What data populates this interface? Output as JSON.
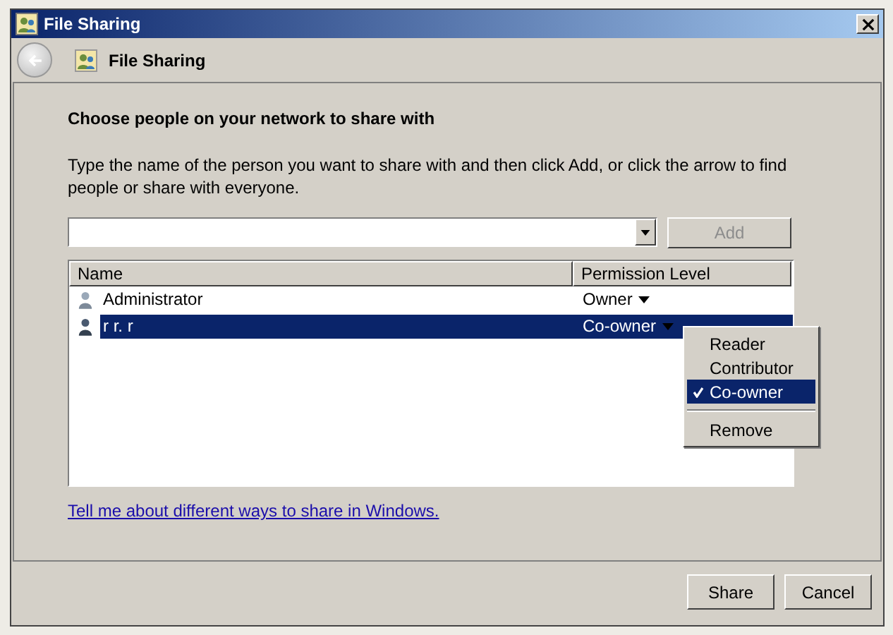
{
  "window": {
    "title": "File Sharing"
  },
  "nav": {
    "title": "File Sharing"
  },
  "heading": "Choose people on your network to share with",
  "instructions": "Type the name of the person you want to share with and then click Add, or click the arrow to find people or share with everyone.",
  "add_button": {
    "label": "Add",
    "disabled": true
  },
  "table": {
    "columns": [
      "Name",
      "Permission Level"
    ],
    "rows": [
      {
        "name": "Administrator",
        "permission": "Owner",
        "selected": false
      },
      {
        "name": "r r. r",
        "permission": "Co-owner",
        "selected": true
      }
    ]
  },
  "context_menu": {
    "items": [
      {
        "kind": "option",
        "label": "Reader",
        "checked": false,
        "selected": false
      },
      {
        "kind": "option",
        "label": "Contributor",
        "checked": false,
        "selected": false
      },
      {
        "kind": "option",
        "label": "Co-owner",
        "checked": true,
        "selected": true
      },
      {
        "kind": "separator"
      },
      {
        "kind": "option",
        "label": "Remove",
        "checked": false,
        "selected": false
      }
    ]
  },
  "link": "Tell me about different ways to share in Windows.",
  "buttons": [
    {
      "label": "Share"
    },
    {
      "label": "Cancel"
    }
  ]
}
